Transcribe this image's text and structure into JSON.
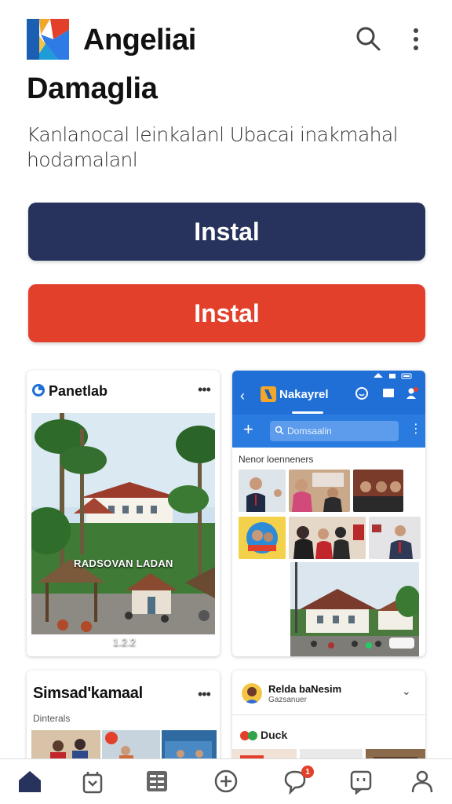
{
  "header": {
    "app_name": "Angeliai",
    "logo": "brand-logo-icon",
    "actions": [
      "search-icon",
      "more-vertical-icon"
    ]
  },
  "page": {
    "title": "Damaglia",
    "description": "Kanlanocal leinkalanl Ubacai inakmahal hodamalanl"
  },
  "buttons": {
    "primary_label": "Instal",
    "secondary_label": "Instal"
  },
  "colors": {
    "primary": "#27335c",
    "secondary": "#e3402b",
    "app_blue": "#1f6fd6",
    "badge": "#e3402b"
  },
  "cards": {
    "a": {
      "title": "Panetlab",
      "menu": "•••",
      "overlay": "RADSOVAN LADAN",
      "overlay_sub": "1.2.2"
    },
    "b": {
      "back": "‹",
      "title": "Nakayrel",
      "search_placeholder": "Domsaalin",
      "section_label": "Nenor loenneners"
    },
    "c": {
      "title": "Simsad'kamaal",
      "menu": "•••",
      "subtitle": "Dinterals"
    },
    "d": {
      "title": "Relda baNesim",
      "subtitle": "Gazsanuer",
      "label": "Duck",
      "chevron": "⌄"
    }
  },
  "bottom_nav": {
    "items": [
      "home-icon",
      "bag-icon",
      "grid-icon",
      "add-icon",
      "chat-icon",
      "inbox-icon",
      "profile-icon"
    ],
    "notification_count": "1"
  }
}
